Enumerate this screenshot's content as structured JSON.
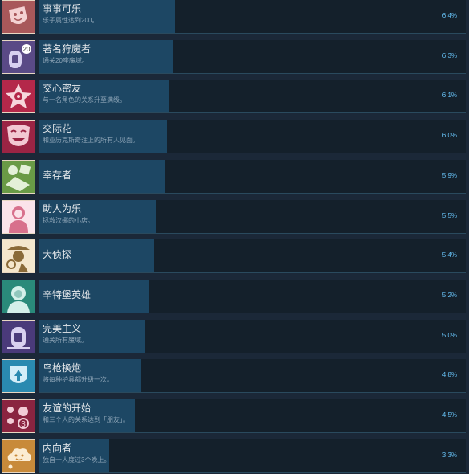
{
  "achievements": [
    {
      "title": "事事可乐",
      "desc": "乐子属性达到200。",
      "percent": "6.4%",
      "fill": 0.064,
      "icon": "theater-mask-icon",
      "colors": [
        "#a8585a",
        "#f4d2d2"
      ]
    },
    {
      "title": "著名狩魔者",
      "desc": "通关20座魔域。",
      "percent": "6.3%",
      "fill": 0.063,
      "icon": "tombstone-20-icon",
      "colors": [
        "#5a4a86",
        "#d8d0f0"
      ]
    },
    {
      "title": "交心密友",
      "desc": "与一名角色的关系升至满级。",
      "percent": "6.1%",
      "fill": 0.061,
      "icon": "star-face-icon",
      "colors": [
        "#b4284a",
        "#f6d6dc"
      ]
    },
    {
      "title": "交际花",
      "desc": "和亚历克斯奇注上的所有人见面。",
      "percent": "6.0%",
      "fill": 0.06,
      "icon": "smiling-mask-icon",
      "colors": [
        "#9a2444",
        "#f2c8d2"
      ]
    },
    {
      "title": "幸存者",
      "desc": "",
      "percent": "5.9%",
      "fill": 0.059,
      "icon": "survivor-ticket-icon",
      "colors": [
        "#6a9a46",
        "#e4f0d8"
      ]
    },
    {
      "title": "助人为乐",
      "desc": "拯救汉娜的小店。",
      "percent": "5.5%",
      "fill": 0.055,
      "icon": "helping-girl-icon",
      "colors": [
        "#d8708c",
        "#fbe3ea"
      ]
    },
    {
      "title": "大侦探",
      "desc": "",
      "percent": "5.4%",
      "fill": 0.054,
      "icon": "detective-icon",
      "colors": [
        "#8a6a38",
        "#f4e6cc"
      ]
    },
    {
      "title": "辛特堡英雄",
      "desc": "",
      "percent": "5.2%",
      "fill": 0.052,
      "icon": "hero-girl-icon",
      "colors": [
        "#2a8a7a",
        "#d4f0ea"
      ]
    },
    {
      "title": "完美主义",
      "desc": "通关所有魔域。",
      "percent": "5.0%",
      "fill": 0.05,
      "icon": "perfect-tombstone-icon",
      "colors": [
        "#4a3a7a",
        "#d8d0f0"
      ]
    },
    {
      "title": "鸟枪换炮",
      "desc": "将每种护具都升级一次。",
      "percent": "4.8%",
      "fill": 0.048,
      "icon": "upgrade-mask-icon",
      "colors": [
        "#2a8ab0",
        "#d4eef8"
      ]
    },
    {
      "title": "友谊的开始",
      "desc": "和三个人的关系达到「朋友」。",
      "percent": "4.5%",
      "fill": 0.045,
      "icon": "three-friends-icon",
      "colors": [
        "#8a2440",
        "#f2ccd6"
      ]
    },
    {
      "title": "内向者",
      "desc": "独自一人度过3个晚上。",
      "percent": "3.3%",
      "fill": 0.033,
      "icon": "introvert-cloud-icon",
      "colors": [
        "#c88a3a",
        "#fbecd2"
      ]
    }
  ]
}
